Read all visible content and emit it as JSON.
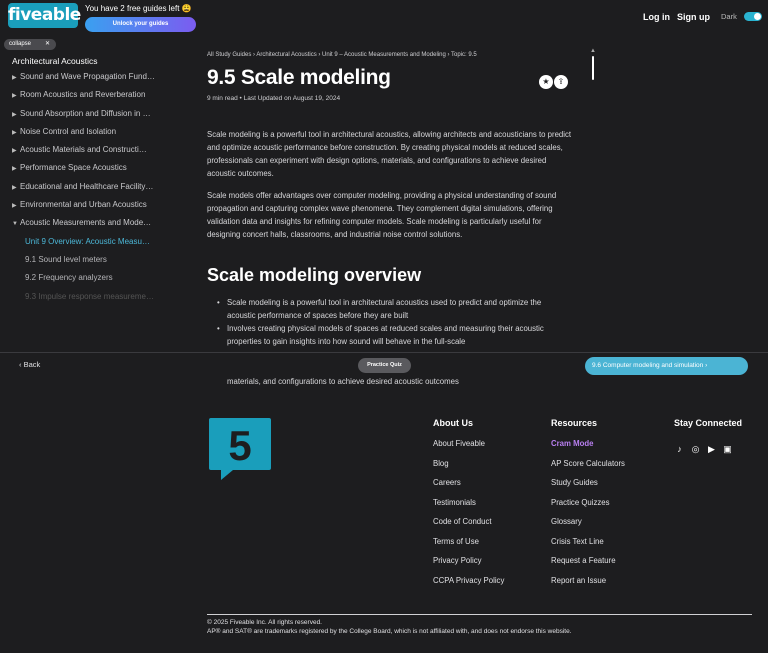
{
  "header": {
    "logo": "fiveable",
    "free_guides": "You have 2 free guides left 😩",
    "unlock": "Unlock your guides",
    "login": "Log in",
    "signup": "Sign up",
    "dark_label": "Dark",
    "dark_on": true
  },
  "sidebar": {
    "collapse": "collapse",
    "title": "Architectural Acoustics",
    "items": [
      "Sound and Wave Propagation Fund…",
      "Room Acoustics and Reverberation",
      "Sound Absorption and Diffusion in …",
      "Noise Control and Isolation",
      "Acoustic Materials and Constructi…",
      "Performance Space Acoustics",
      "Educational and Healthcare Facility…",
      "Environmental and Urban Acoustics",
      "Acoustic Measurements and Mode…"
    ],
    "subitems": [
      {
        "label": "Unit 9 Overview: Acoustic Measu…",
        "state": "active"
      },
      {
        "label": "9.1 Sound level meters",
        "state": "normal"
      },
      {
        "label": "9.2 Frequency analyzers",
        "state": "normal"
      },
      {
        "label": "9.3 Impulse response measureme…",
        "state": "faded"
      }
    ]
  },
  "main": {
    "breadcrumb": "All Study Guides › Architectural Acoustics › Unit 9 – Acoustic Measurements and Modeling › Topic: 9.5",
    "title": "9.5 Scale modeling",
    "meta": "9 min read • Last Updated on August 19, 2024",
    "p1": "Scale modeling is a powerful tool in architectural acoustics, allowing architects and acousticians to predict and optimize acoustic performance before construction. By creating physical models at reduced scales, professionals can experiment with design options, materials, and configurations to achieve desired acoustic outcomes.",
    "p2": "Scale models offer advantages over computer modeling, providing a physical understanding of sound propagation and capturing complex wave phenomena. They complement digital simulations, offering validation data and insights for refining computer models. Scale modeling is particularly useful for designing concert halls, classrooms, and industrial noise control solutions.",
    "h2": "Scale modeling overview",
    "bullets": [
      "Scale modeling is a powerful tool in architectural acoustics used to predict and optimize the acoustic performance of spaces before they are built",
      "Involves creating physical models of spaces at reduced scales and measuring their acoustic properties to gain insights into how sound will behave in the full-scale"
    ],
    "cut_line": "materials, and configurations to achieve desired acoustic outcomes"
  },
  "nav": {
    "back": "Back",
    "quiz": "Practice Quiz",
    "next": "9.6 Computer modeling and simulation"
  },
  "footer": {
    "logo_digit": "5",
    "about": {
      "title": "About Us",
      "links": [
        "About Fiveable",
        "Blog",
        "Careers",
        "Testimonials",
        "Code of Conduct",
        "Terms of Use",
        "Privacy Policy",
        "CCPA Privacy Policy"
      ]
    },
    "resources": {
      "title": "Resources",
      "links": [
        "Cram Mode",
        "AP Score Calculators",
        "Study Guides",
        "Practice Quizzes",
        "Glossary",
        "Crisis Text Line",
        "Request a Feature",
        "Report an Issue"
      ]
    },
    "connect": {
      "title": "Stay Connected"
    },
    "copyright": "© 2025 Fiveable Inc. All rights reserved.",
    "trademark": "AP® and SAT® are trademarks registered by the College Board, which is not affiliated with, and does not endorse this website."
  },
  "colors": {
    "accent": "#4bb4d4",
    "logo": "#1a9ebb",
    "cram": "#b87ff0",
    "background": "#1d1d1f"
  }
}
